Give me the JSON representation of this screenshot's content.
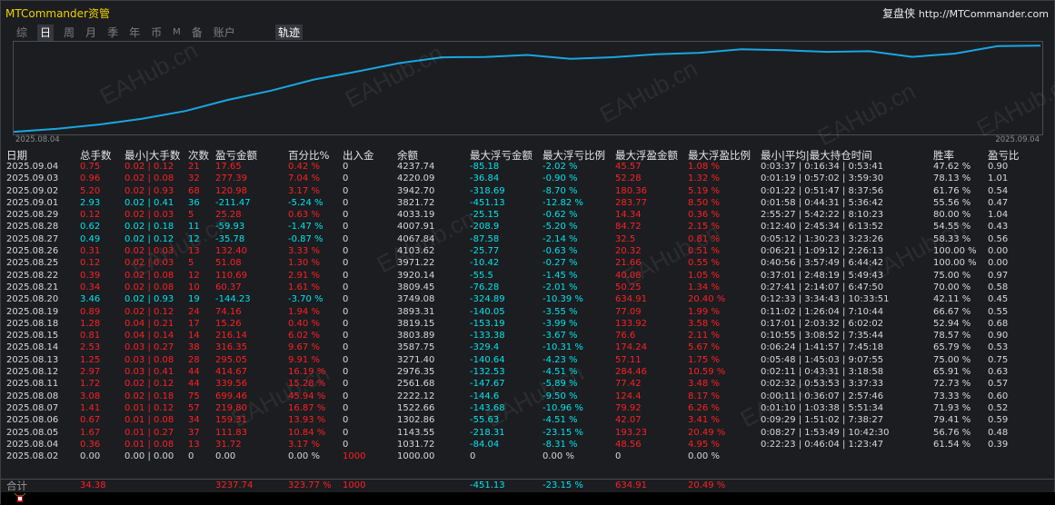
{
  "app": {
    "title": "MTCommander资管",
    "brand_name": "复盘侠",
    "brand_url": "http://MTCommander.com"
  },
  "tabs": [
    {
      "label": "综",
      "active": false
    },
    {
      "label": "日",
      "active": true
    },
    {
      "label": "周",
      "active": false
    },
    {
      "label": "月",
      "active": false
    },
    {
      "label": "季",
      "active": false
    },
    {
      "label": "年",
      "active": false
    },
    {
      "label": "币",
      "active": false
    },
    {
      "label": "M",
      "active": false
    },
    {
      "label": "备",
      "active": false
    },
    {
      "label": "账户",
      "active": false
    }
  ],
  "track_button": "轨迹",
  "chart_data": {
    "type": "line",
    "x_start_label": "2025.08.04",
    "x_end_label": "2025.09.04",
    "color": "#1aa6e0",
    "series": [
      {
        "name": "",
        "values": [
          1031.72,
          1143.55,
          1302.86,
          1522.66,
          1807.0,
          2222.12,
          2561.68,
          2976.35,
          3271.4,
          3587.75,
          3803.89,
          3819.15,
          3893.31,
          3749.08,
          3809.45,
          3920.14,
          3971.22,
          4103.62,
          4067.84,
          4007.91,
          4033.19,
          3821.72,
          3942.7,
          4220.09,
          4237.74
        ]
      }
    ],
    "grid": false
  },
  "watermark": "EAHub.cn",
  "table": {
    "headers": [
      "日期",
      "总手数",
      "最小|大手数",
      "次数",
      "盈亏金额",
      "百分比%",
      "出入金",
      "余额",
      "最大浮亏金额",
      "最大浮亏比例",
      "最大浮盈金额",
      "最大浮盈比例",
      "最小|平均|最大持仓时间",
      "胜率",
      "盈亏比"
    ],
    "rows": [
      [
        "2025.09.04",
        "0.75",
        "0.02 | 0.12",
        "21",
        "17.65",
        "0.42 %",
        "0",
        "4237.74",
        "-85.18",
        "-2.02 %",
        "45.57",
        "1.08 %",
        "0:03:37 | 0:16:34 | 0:53:41",
        "47.62 %",
        "0.90"
      ],
      [
        "2025.09.03",
        "0.96",
        "0.02 | 0.08",
        "32",
        "277.39",
        "7.04 %",
        "0",
        "4220.09",
        "-36.84",
        "-0.90 %",
        "52.28",
        "1.32 %",
        "0:01:19 | 0:57:02 | 3:59:30",
        "78.13 %",
        "1.01"
      ],
      [
        "2025.09.02",
        "5.20",
        "0.02 | 0.93",
        "68",
        "120.98",
        "3.17 %",
        "0",
        "3942.70",
        "-318.69",
        "-8.70 %",
        "180.36",
        "5.19 %",
        "0:01:22 | 0:51:47 | 8:37:56",
        "61.76 %",
        "0.54"
      ],
      [
        "2025.09.01",
        "2.93",
        "0.02 | 0.41",
        "36",
        "-211.47",
        "-5.24 %",
        "0",
        "3821.72",
        "-451.13",
        "-12.82 %",
        "283.77",
        "8.50 %",
        "0:01:58 | 0:44:31 | 5:36:42",
        "55.56 %",
        "0.47"
      ],
      [
        "2025.08.29",
        "0.12",
        "0.02 | 0.03",
        "5",
        "25.28",
        "0.63 %",
        "0",
        "4033.19",
        "-25.15",
        "-0.62 %",
        "14.34",
        "0.36 %",
        "2:55:27 | 5:42:22 | 8:10:23",
        "80.00 %",
        "1.04"
      ],
      [
        "2025.08.28",
        "0.62",
        "0.02 | 0.18",
        "11",
        "-59.93",
        "-1.47 %",
        "0",
        "4007.91",
        "-208.9",
        "-5.20 %",
        "84.72",
        "2.15 %",
        "0:12:40 | 2:45:34 | 6:13:52",
        "54.55 %",
        "0.43"
      ],
      [
        "2025.08.27",
        "0.49",
        "0.02 | 0.12",
        "12",
        "-35.78",
        "-0.87 %",
        "0",
        "4067.84",
        "-87.58",
        "-2.14 %",
        "32.5",
        "0.81 %",
        "0:05:12 | 1:30:23 | 3:23:26",
        "58.33 %",
        "0.56"
      ],
      [
        "2025.08.26",
        "0.31",
        "0.02 | 0.03",
        "13",
        "132.40",
        "3.33 %",
        "0",
        "4103.62",
        "-25.77",
        "-0.63 %",
        "20.32",
        "0.51 %",
        "0:06:21 | 1:09:12 | 2:26:13",
        "100.00 %",
        "0.00"
      ],
      [
        "2025.08.25",
        "0.12",
        "0.02 | 0.03",
        "5",
        "51.08",
        "1.30 %",
        "0",
        "3971.22",
        "-10.42",
        "-0.27 %",
        "21.66",
        "0.55 %",
        "0:40:56 | 3:57:49 | 6:44:42",
        "100.00 %",
        "0.00"
      ],
      [
        "2025.08.22",
        "0.39",
        "0.02 | 0.08",
        "12",
        "110.69",
        "2.91 %",
        "0",
        "3920.14",
        "-55.5",
        "-1.45 %",
        "40.08",
        "1.05 %",
        "0:37:01 | 2:48:19 | 5:49:43",
        "75.00 %",
        "0.97"
      ],
      [
        "2025.08.21",
        "0.34",
        "0.02 | 0.08",
        "10",
        "60.37",
        "1.61 %",
        "0",
        "3809.45",
        "-76.28",
        "-2.01 %",
        "50.25",
        "1.34 %",
        "0:27:41 | 2:14:07 | 6:47:50",
        "70.00 %",
        "0.58"
      ],
      [
        "2025.08.20",
        "3.46",
        "0.02 | 0.93",
        "19",
        "-144.23",
        "-3.70 %",
        "0",
        "3749.08",
        "-324.89",
        "-10.39 %",
        "634.91",
        "20.40 %",
        "0:12:33 | 3:34:43 | 10:33:51",
        "42.11 %",
        "0.45"
      ],
      [
        "2025.08.19",
        "0.89",
        "0.02 | 0.12",
        "24",
        "74.16",
        "1.94 %",
        "0",
        "3893.31",
        "-140.05",
        "-3.55 %",
        "77.09",
        "1.99 %",
        "0:11:02 | 1:26:04 | 7:10:44",
        "66.67 %",
        "0.55"
      ],
      [
        "2025.08.18",
        "1.28",
        "0.04 | 0.21",
        "17",
        "15.26",
        "0.40 %",
        "0",
        "3819.15",
        "-153.19",
        "-3.99 %",
        "133.92",
        "3.58 %",
        "0:17:01 | 2:03:32 | 6:02:02",
        "52.94 %",
        "0.68"
      ],
      [
        "2025.08.15",
        "0.81",
        "0.04 | 0.14",
        "14",
        "216.14",
        "6.02 %",
        "0",
        "3803.89",
        "-133.38",
        "-3.67 %",
        "76.6",
        "2.11 %",
        "0:10:55 | 3:08:52 | 7:35:44",
        "78.57 %",
        "0.90"
      ],
      [
        "2025.08.14",
        "2.53",
        "0.03 | 0.27",
        "38",
        "316.35",
        "9.67 %",
        "0",
        "3587.75",
        "-329.4",
        "-10.31 %",
        "174.24",
        "5.67 %",
        "0:06:24 | 1:41:57 | 7:45:18",
        "65.79 %",
        "0.53"
      ],
      [
        "2025.08.13",
        "1.25",
        "0.03 | 0.08",
        "28",
        "295.05",
        "9.91 %",
        "0",
        "3271.40",
        "-140.64",
        "-4.23 %",
        "57.11",
        "1.75 %",
        "0:05:48 | 1:45:03 | 9:07:55",
        "75.00 %",
        "0.75"
      ],
      [
        "2025.08.12",
        "2.97",
        "0.03 | 0.41",
        "44",
        "414.67",
        "16.19 %",
        "0",
        "2976.35",
        "-132.53",
        "-4.51 %",
        "284.46",
        "10.59 %",
        "0:02:11 | 0:43:31 | 3:18:58",
        "65.91 %",
        "0.63"
      ],
      [
        "2025.08.11",
        "1.72",
        "0.02 | 0.12",
        "44",
        "339.56",
        "15.28 %",
        "0",
        "2561.68",
        "-147.67",
        "-5.89 %",
        "77.42",
        "3.48 %",
        "0:02:32 | 0:53:53 | 3:37:33",
        "72.73 %",
        "0.57"
      ],
      [
        "2025.08.08",
        "3.08",
        "0.02 | 0.18",
        "75",
        "699.46",
        "45.94 %",
        "0",
        "2222.12",
        "-144.6",
        "-9.50 %",
        "124.4",
        "8.17 %",
        "0:00:11 | 0:36:07 | 2:57:46",
        "73.33 %",
        "0.60"
      ],
      [
        "2025.08.07",
        "1.41",
        "0.01 | 0.12",
        "57",
        "219.80",
        "16.87 %",
        "0",
        "1522.66",
        "-143.68",
        "-10.96 %",
        "79.92",
        "6.26 %",
        "0:01:10 | 1:03:38 | 5:51:34",
        "71.93 %",
        "0.52"
      ],
      [
        "2025.08.06",
        "0.67",
        "0.01 | 0.08",
        "34",
        "159.31",
        "13.93 %",
        "0",
        "1302.86",
        "-55.63",
        "-4.51 %",
        "42.07",
        "3.41 %",
        "0:09:29 | 1:51:02 | 7:38:27",
        "79.41 %",
        "0.59"
      ],
      [
        "2025.08.05",
        "1.67",
        "0.01 | 0.27",
        "37",
        "111.83",
        "10.84 %",
        "0",
        "1143.55",
        "-218.31",
        "-23.15 %",
        "193.23",
        "20.49 %",
        "0:08:27 | 1:53:49 | 10:42:30",
        "56.76 %",
        "0.48"
      ],
      [
        "2025.08.04",
        "0.36",
        "0.01 | 0.08",
        "13",
        "31.72",
        "3.17 %",
        "0",
        "1031.72",
        "-84.04",
        "-8.31 %",
        "48.56",
        "4.95 %",
        "0:22:23 | 0:46:04 | 1:23:47",
        "61.54 %",
        "0.39"
      ],
      [
        "2025.08.02",
        "0.00",
        "0.00 | 0.00",
        "0",
        "0.00",
        "0.00 %",
        "1000",
        "1000.00",
        "0",
        "0.00 %",
        "0",
        "0.00 %",
        "",
        "",
        ""
      ]
    ],
    "total": {
      "label": "合计",
      "lots": "34.38",
      "pnl": "3237.74",
      "pct": "323.77 %",
      "deposit": "1000",
      "max_float_loss": "-451.13",
      "max_float_loss_pct": "-23.15 %",
      "max_float_profit": "634.91",
      "max_float_profit_pct": "20.49 %"
    }
  },
  "colors": {
    "title": "#f0d000",
    "positive": "#ff2020",
    "negative": "#00e4ec",
    "neutral": "#d8d8d8",
    "line": "#1aa6e0"
  }
}
